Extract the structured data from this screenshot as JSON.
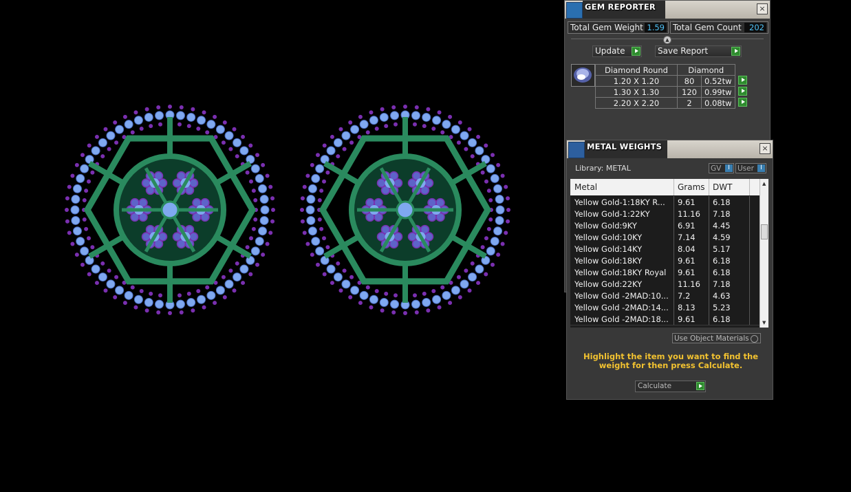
{
  "gem_reporter": {
    "title": "GEM REPORTER",
    "close": "×",
    "total_weight_label": "Total Gem Weight",
    "total_weight_value": "1.59",
    "total_count_label": "Total Gem Count",
    "total_count_value": "202",
    "update_label": "Update",
    "save_report_label": "Save Report",
    "table": {
      "headers": [
        "Diamond Round",
        "Diamond"
      ],
      "rows": [
        {
          "size": "1.20 X 1.20",
          "count": "80",
          "weight": "0.52tw"
        },
        {
          "size": "1.30 X 1.30",
          "count": "120",
          "weight": "0.99tw"
        },
        {
          "size": "2.20 X 2.20",
          "count": "2",
          "weight": "0.08tw"
        }
      ]
    }
  },
  "metal_weights": {
    "title": "METAL WEIGHTS",
    "close": "×",
    "library_label": "Library: METAL",
    "gv_label": "GV",
    "user_label": "User",
    "columns": [
      "Metal",
      "Grams",
      "DWT"
    ],
    "rows": [
      {
        "metal": "Yellow Gold-1:18KY R...",
        "grams": "9.61",
        "dwt": "6.18"
      },
      {
        "metal": "Yellow Gold-1:22KY",
        "grams": "11.16",
        "dwt": "7.18"
      },
      {
        "metal": "Yellow Gold:9KY",
        "grams": "6.91",
        "dwt": "4.45"
      },
      {
        "metal": "Yellow Gold:10KY",
        "grams": "7.14",
        "dwt": "4.59"
      },
      {
        "metal": "Yellow Gold:14KY",
        "grams": "8.04",
        "dwt": "5.17"
      },
      {
        "metal": "Yellow Gold:18KY",
        "grams": "9.61",
        "dwt": "6.18"
      },
      {
        "metal": "Yellow Gold:18KY Royal",
        "grams": "9.61",
        "dwt": "6.18"
      },
      {
        "metal": "Yellow Gold:22KY",
        "grams": "11.16",
        "dwt": "7.18"
      },
      {
        "metal": "Yellow Gold -2MAD:10...",
        "grams": "7.2",
        "dwt": "4.63"
      },
      {
        "metal": "Yellow Gold -2MAD:14...",
        "grams": "8.13",
        "dwt": "5.23"
      },
      {
        "metal": "Yellow Gold -2MAD:18...",
        "grams": "9.61",
        "dwt": "6.18"
      }
    ],
    "use_object_materials_label": "Use Object Materials",
    "hint": "Highlight the item you want to find the weight for then press Calculate.",
    "calculate_label": "Calculate"
  },
  "colors": {
    "metal_green": "#2a8a5e",
    "gem_blue": "#7fa8f0",
    "prong_purple": "#7a2fb0",
    "accent_gold": "#f2c230",
    "value_blue": "#4fc3f7"
  }
}
